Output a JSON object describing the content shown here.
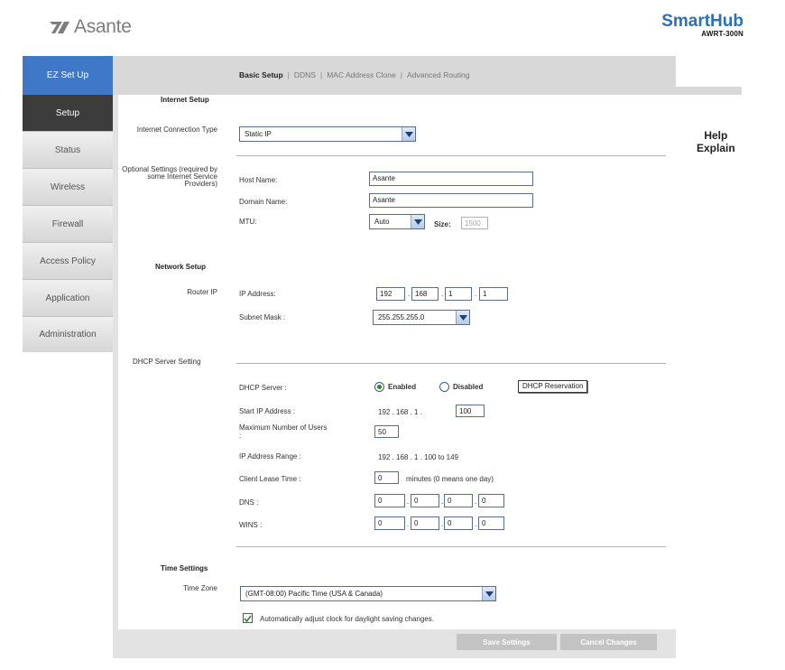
{
  "header": {
    "logo_text": "Asante",
    "brand_title": "SmartHub",
    "brand_model": "AWRT-300N"
  },
  "topnav": {
    "ez_setup": "EZ Set Up",
    "tabs": [
      "Basic Setup",
      "DDNS",
      "MAC Address Clone",
      "Advanced Routing"
    ],
    "separator": "|",
    "active_tab": "Basic Setup"
  },
  "sidebar": {
    "items": [
      "Setup",
      "Status",
      "Wireless",
      "Firewall",
      "Access Policy",
      "Application",
      "Administration"
    ],
    "active": "Setup"
  },
  "help": {
    "line1": "Help",
    "line2": "Explain"
  },
  "internet_setup": {
    "title": "Internet Setup",
    "connection_type_label": "Internet Connection Type",
    "connection_type_value": "Static IP",
    "optional_label": "Optional Settings (required by some Internet Service Providers)",
    "host_name_label": "Host Name:",
    "host_name_value": "Asante",
    "domain_name_label": "Domain Name:",
    "domain_name_value": "Asante",
    "mtu_label": "MTU:",
    "mtu_value": "Auto",
    "size_label": "Size:",
    "size_value": "1500"
  },
  "network_setup": {
    "title": "Network Setup",
    "router_ip_label": "Router IP",
    "ip_label": "IP Address:",
    "ip": [
      "192",
      "168",
      "1",
      "1"
    ],
    "subnet_label": "Subnet Mask :",
    "subnet_value": "255.255.255.0"
  },
  "dhcp": {
    "title": "DHCP Server Setting",
    "server_label": "DHCP Server :",
    "enabled_label": "Enabled",
    "disabled_label": "Disabled",
    "enabled_selected": true,
    "reservation_button": "DHCP Reservation",
    "start_ip_label": "Start IP Address :",
    "start_ip_prefix": "192  .  168  .  1  .",
    "start_ip_last": "100",
    "max_users_label": "Maximum Number of Users :",
    "max_users_value": "50",
    "range_label": "IP Address Range :",
    "range_value": "192  .  168  .  1  .  100 to 149",
    "lease_label": "Client Lease Time :",
    "lease_value": "0",
    "lease_note": "minutes (0 means one day)",
    "dns_label": "DNS :",
    "dns": [
      "0",
      "0",
      "0",
      "0"
    ],
    "wins_label": "WINS :",
    "wins": [
      "0",
      "0",
      "0",
      "0"
    ]
  },
  "time": {
    "title": "Time Settings",
    "zone_label": "Time Zone",
    "zone_value": "(GMT-08:00) Pacific Time (USA & Canada)",
    "dst_checked": true,
    "dst_label": "Automatically adjust clock for daylight saving changes."
  },
  "buttons": {
    "save": "Save Settings",
    "cancel": "Cancel Changes"
  },
  "colors": {
    "accent_blue": "#3f78c6",
    "brand_blue": "#2f6fb5",
    "sidebar_active": "#3c3c3c",
    "button_gray": "#c3c3c3"
  }
}
